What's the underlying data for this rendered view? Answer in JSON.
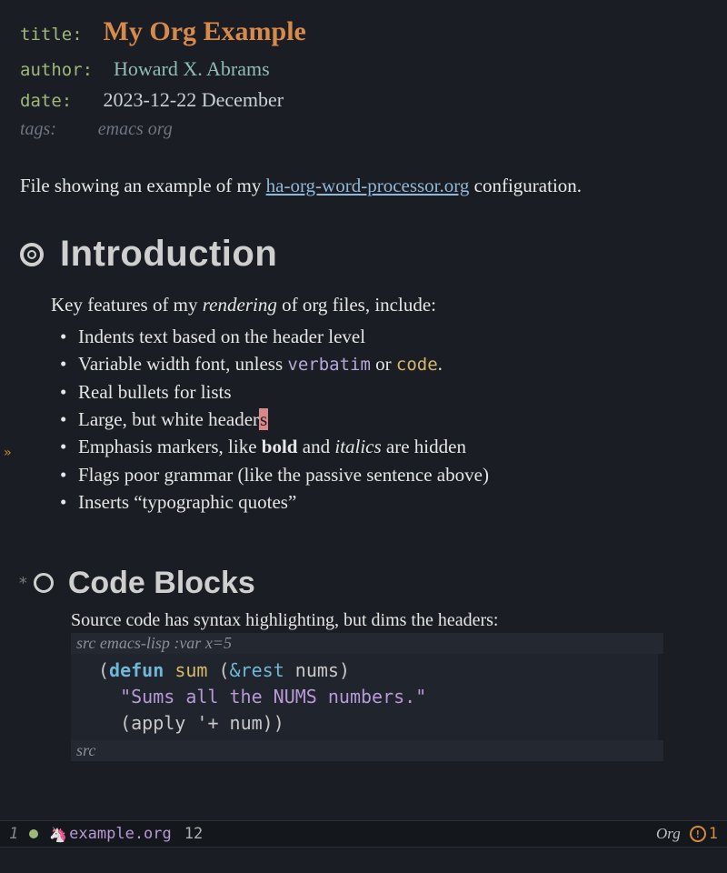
{
  "meta": {
    "title_key": "title",
    "title_val": "My Org Example",
    "author_key": "author",
    "author_val": "Howard X. Abrams",
    "date_key": "date",
    "date_val": "2023-12-22 December",
    "tags_key": "tags:",
    "tags_val": "emacs org"
  },
  "intro_para": {
    "pre": "File showing an example of my ",
    "link": "ha-org-word-processor.org",
    "post": " configuration."
  },
  "sections": {
    "introduction": {
      "heading": "Introduction",
      "lead_pre": "Key features of my ",
      "lead_em": "rendering",
      "lead_post": " of org files, include:",
      "bullets": {
        "b1": "Indents text based on the header level",
        "b2_pre": "Variable width font, unless ",
        "b2_verb": "verbatim",
        "b2_mid": " or ",
        "b2_code": "code",
        "b2_post": ".",
        "b3": "Real bullets for lists",
        "b4_pre": "Large, but white header",
        "b4_cursor": "s",
        "b5_pre": "Emphasis markers, like ",
        "b5_bold": "bold",
        "b5_mid": " and ",
        "b5_ital": "italics",
        "b5_post": " are hidden",
        "b6": "Flags poor grammar (like the passive sentence above)",
        "b7": "Inserts “typographic quotes”"
      }
    },
    "code_blocks": {
      "heading": "Code Blocks",
      "lead": "Source code has syntax highlighting, but dims the headers:",
      "src_begin_kw": "src",
      "src_begin_args": " emacs-lisp :var x=5",
      "src_end_kw": "src",
      "code": {
        "l1_open": "(",
        "l1_def": "defun",
        "l1_sp1": " ",
        "l1_fn": "sum",
        "l1_sp2": " (",
        "l1_rest": "&rest",
        "l1_sp3": " ",
        "l1_arg": "nums",
        "l1_close": ")",
        "l2_indent": "  ",
        "l2_str": "\"Sums all the NUMS numbers.\"",
        "l3_indent": "  ",
        "l3_open": "(",
        "l3_apply": "apply",
        "l3_sp": " '",
        "l3_plus": "+",
        "l3_sp2": " ",
        "l3_num": "num",
        "l3_close": "))"
      }
    }
  },
  "modeline": {
    "window": "1",
    "file": "example.org",
    "line": "12",
    "mode": "Org",
    "warn_count": "1"
  }
}
